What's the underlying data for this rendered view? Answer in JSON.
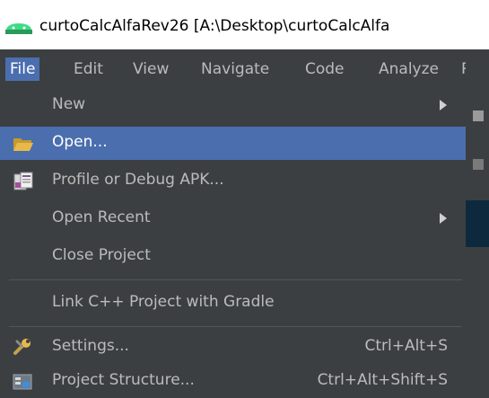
{
  "window": {
    "title": "curtoCalcAlfaRev26 [A:\\Desktop\\curtoCalcAlfa"
  },
  "menubar": {
    "items": [
      {
        "label": "File",
        "active": true
      },
      {
        "label": "Edit"
      },
      {
        "label": "View"
      },
      {
        "label": "Navigate"
      },
      {
        "label": "Code"
      },
      {
        "label": "Analyze"
      },
      {
        "label": "R"
      }
    ]
  },
  "file_menu": {
    "items": [
      {
        "label": "New",
        "submenu": true
      },
      {
        "label": "Open...",
        "icon": "folder-open-icon",
        "selected": true
      },
      {
        "label": "Profile or Debug APK...",
        "icon": "apk-icon"
      },
      {
        "label": "Open Recent",
        "submenu": true
      },
      {
        "label": "Close Project"
      },
      {
        "label": "Link C++ Project with Gradle"
      },
      {
        "label": "Settings...",
        "icon": "wrench-icon",
        "shortcut": "Ctrl+Alt+S"
      },
      {
        "label": "Project Structure...",
        "icon": "project-structure-icon",
        "shortcut": "Ctrl+Alt+Shift+S"
      }
    ]
  },
  "colors": {
    "menu_bg": "#3c3f41",
    "selection": "#4b6eaf",
    "text": "#bbbbbb"
  }
}
